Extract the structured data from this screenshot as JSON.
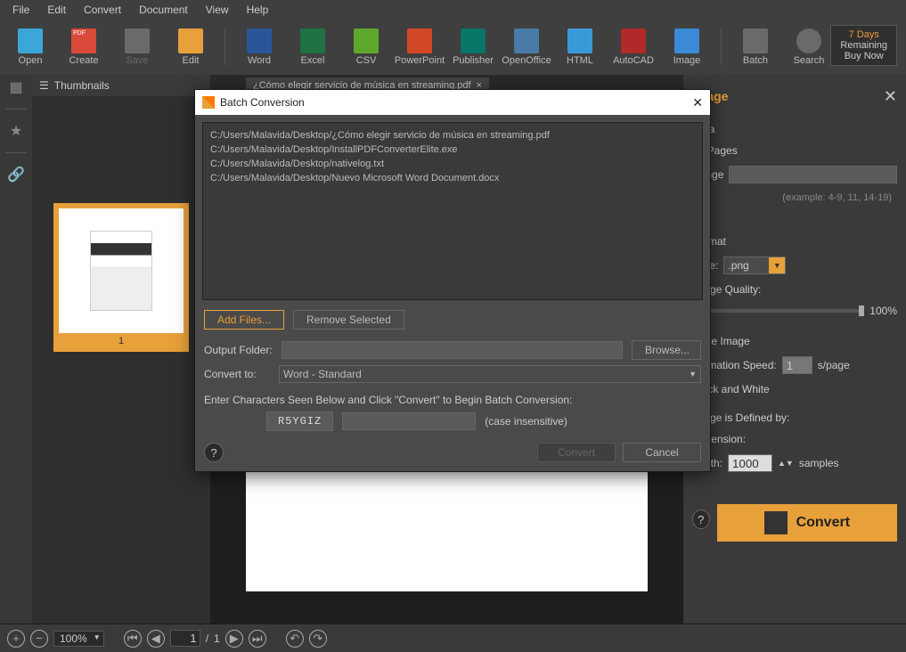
{
  "menu": {
    "file": "File",
    "edit": "Edit",
    "convert": "Convert",
    "document": "Document",
    "view": "View",
    "help": "Help"
  },
  "toolbar": {
    "open": "Open",
    "create": "Create",
    "save": "Save",
    "edit": "Edit",
    "word": "Word",
    "excel": "Excel",
    "csv": "CSV",
    "powerpoint": "PowerPoint",
    "publisher": "Publisher",
    "openoffice": "OpenOffice",
    "html": "HTML",
    "autocad": "AutoCAD",
    "image": "Image",
    "batch": "Batch",
    "search": "Search"
  },
  "trial": {
    "days": "7 Days",
    "remaining": "Remaining",
    "buy": "Buy Now"
  },
  "thumbs": {
    "title": "Thumbnails",
    "page_number": "1"
  },
  "tab": {
    "title": "¿Cómo elegir servicio de música en streaming.pdf",
    "close": "×"
  },
  "right": {
    "title": "Image",
    "close": "✕",
    "area": "Area",
    "allpages": "All Pages",
    "range": "Range",
    "range_hint": "(example: 4-9, 11, 14-19)",
    "format": "Format",
    "type_label": "Type:",
    "type_value": ".png",
    "quality_label": "Image Quality:",
    "quality_value": "100%",
    "page_image": "Page Image",
    "anim_label": "Animation Speed:",
    "anim_value": "1",
    "anim_unit": "s/page",
    "bw": "Black and White",
    "defined": "Image is Defined by:",
    "dimension": "Dimension:",
    "width_label": "Width:",
    "width_value": "1000",
    "width_unit": "samples",
    "convert": "Convert"
  },
  "bottom": {
    "zoom": "100%",
    "page_current": "1",
    "page_total": "1",
    "page_sep": "/"
  },
  "modal": {
    "title": "Batch Conversion",
    "files": [
      "C:/Users/Malavida/Desktop/¿Cómo elegir servicio de música en streaming.pdf",
      "C:/Users/Malavida/Desktop/InstallPDFConverterElite.exe",
      "C:/Users/Malavida/Desktop/nativelog.txt",
      "C:/Users/Malavida/Desktop/Nuevo Microsoft Word Document.docx"
    ],
    "add_files": "Add Files...",
    "remove": "Remove Selected",
    "output_label": "Output Folder:",
    "browse": "Browse...",
    "convert_to_label": "Convert to:",
    "convert_to_value": "Word - Standard",
    "captcha_instr": "Enter Characters Seen Below and Click \"Convert\" to Begin Batch Conversion:",
    "captcha": "R5YGIZ",
    "captcha_hint": "(case insensitive)",
    "convert": "Convert",
    "cancel": "Cancel",
    "close": "✕"
  }
}
